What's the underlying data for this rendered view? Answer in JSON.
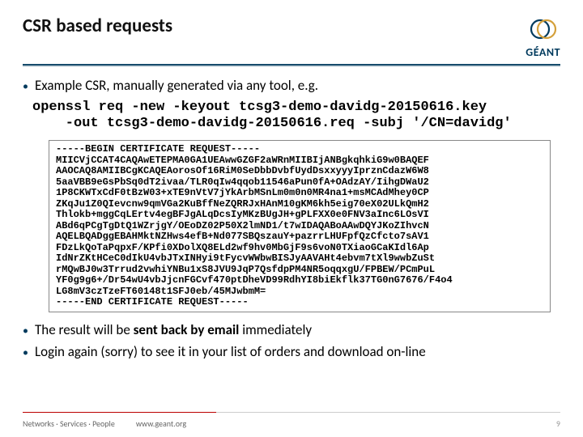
{
  "header": {
    "title": "CSR based requests",
    "logo_text": "GÉANT"
  },
  "bullets": {
    "b1": "Example CSR, manually generated via any tool, e.g.",
    "b2_pre": "The result will be ",
    "b2_bold": "sent back by email",
    "b2_post": " immediately",
    "b3": "Login again (sorry) to see it in your list of orders and download on-line"
  },
  "command": "openssl req -new -keyout tcsg3-demo-davidg-20150616.key\n    -out tcsg3-demo-davidg-20150616.req -subj '/CN=davidg'",
  "cert": "-----BEGIN CERTIFICATE REQUEST-----\nMIICVjCCAT4CAQAwETEPMA0GA1UEAwwGZGF2aWRnMIIBIjANBgkqhkiG9w0BAQEF\nAAOCAQ8AMIIBCgKCAQEAorosOf16RiM0SeDbbDvbfUydDsxxyyyIprznCdazW6W8\n5aaVBB9eGsPbSq0dT2ivaa/TLR0qIw4qqob11546aPun0fA+OAdzAY/IihgDWaU2\n1P8CKWTxCdF0tBzW03+xTE9nVtV7jYkArbMSnLm0m0n0MR4na1+msMCAdMhey0CP\nZKqJu1Z0QIevcnw9qmVGa2KuBffNeZQRRJxHAnM10gKM6kh5eig70eX02ULkQmH2\nThlokb+mggCqLErtv4egBFJgALqDcsIyMKzBUgJH+gPLFXX0e0FNV3aInc6LOsVI\nABd6qPCgTgDtQ1WZrjgY/OEoDZ02P50X2lmND1/t7wIDAQABoAAwDQYJKoZIhvcN\nAQELBQADggEBAHMktNZHws4efB+Nd077SBQszauY+pazrrLHUFpfQzCfcto7sAV1\nFDzLkQoTaPqpxF/KPfi0XDolXQ8ELd2wf9hv0MbGjF9s6voN0TXiaoGCaKIdl6Ap\nIdNrZKtHCeC0dIkU4vbJTxINHyi9tFycvWWbwBISJyAAVAHt4ebvm7tXl9wwbZuSt\nrMQwBJ0w3Trrud2vwhiYNBu1xS8JVU9JqP7QsfdpPM4NR5oqqxgU/FPBEW/PCmPuL\nYF0g9g6+/Dr54wU4vbJjcnFGCvf470ptDheVD99RdhYI8biEkflk37TG0nG7676/F4o4\nLG8mV3czTzeFT60148t1SFJ0eb/45MJwbmM=\n-----END CERTIFICATE REQUEST-----",
  "footer": {
    "left1": "Networks · Services · People",
    "left2": "www.geant.org",
    "page": "9"
  }
}
